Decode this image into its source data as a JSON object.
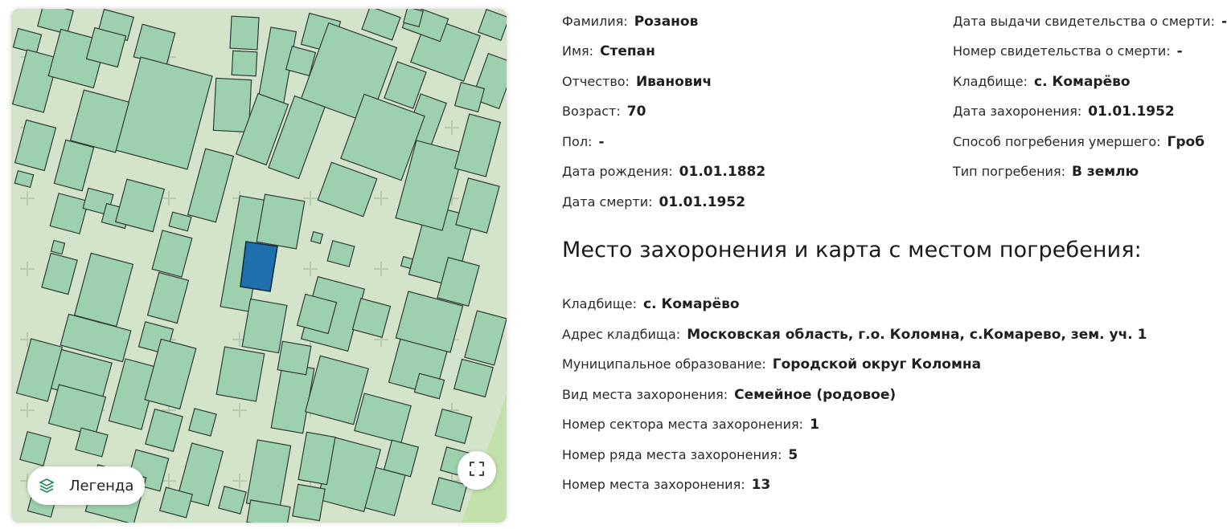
{
  "person": {
    "surname": {
      "label": "Фамилия:",
      "value": "Розанов"
    },
    "name": {
      "label": "Имя:",
      "value": "Степан"
    },
    "patronymic": {
      "label": "Отчество:",
      "value": "Иванович"
    },
    "age": {
      "label": "Возраст:",
      "value": "70"
    },
    "sex": {
      "label": "Пол:",
      "value": "-"
    },
    "birth_date": {
      "label": "Дата рождения:",
      "value": "01.01.1882"
    },
    "death_date": {
      "label": "Дата смерти:",
      "value": "01.01.1952"
    }
  },
  "burial": {
    "certificate_date": {
      "label": "Дата выдачи свидетельства о смерти:",
      "value": "-"
    },
    "certificate_number": {
      "label": "Номер свидетельства о смерти:",
      "value": "-"
    },
    "cemetery": {
      "label": "Кладбище:",
      "value": "с. Комарёво"
    },
    "burial_date": {
      "label": "Дата захоронения:",
      "value": "01.01.1952"
    },
    "burial_method": {
      "label": "Способ погребения умершего:",
      "value": "Гроб"
    },
    "burial_type": {
      "label": "Тип погребения:",
      "value": "В землю"
    }
  },
  "location": {
    "title": "Место захоронения и карта с местом погребения:",
    "cemetery": {
      "label": "Кладбище:",
      "value": "с. Комарёво"
    },
    "address": {
      "label": "Адрес кладбища:",
      "value": "Московская область, г.о. Коломна, с.Комарево, зем. уч. 1"
    },
    "municipality": {
      "label": "Муниципальное образование:",
      "value": "Городской округ Коломна"
    },
    "place_kind": {
      "label": "Вид места захоронения:",
      "value": "Семейное (родовое)"
    },
    "sector": {
      "label": "Номер сектора места захоронения:",
      "value": "1"
    },
    "row": {
      "label": "Номер ряда места захоронения:",
      "value": "5"
    },
    "place_number": {
      "label": "Номер места захоронения:",
      "value": "13"
    }
  },
  "map": {
    "legend_label": "Легенда",
    "legend_icon": "layers-icon",
    "expand_icon": "fullscreen-icon",
    "colors": {
      "background": "#d4e4cb",
      "plot_fill": "#9dd0ae",
      "plot_stroke": "#2f3a35",
      "selected_plot": "#1f6fad",
      "grass": "#bfe0a8"
    }
  }
}
